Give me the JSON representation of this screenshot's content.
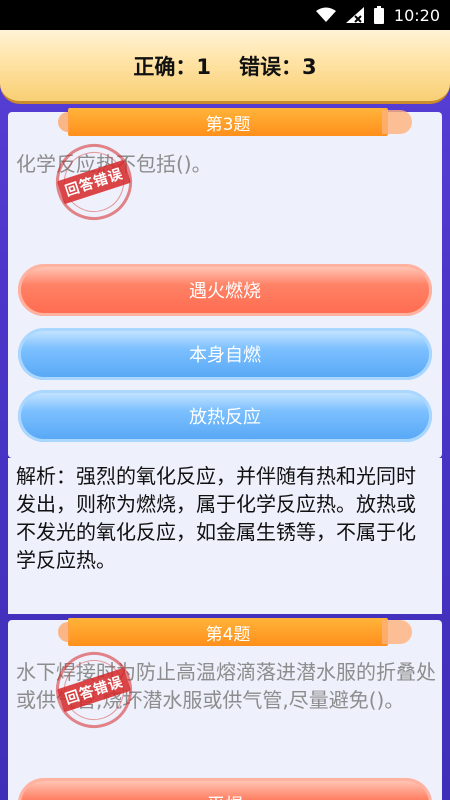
{
  "status_bar": {
    "time": "10:20"
  },
  "score": {
    "correct": "正确：1",
    "wrong": "错误：3"
  },
  "questions": [
    {
      "number_label": "第3题",
      "text": "化学反应热不包括()。",
      "stamp": "回答错误",
      "options": [
        "遇火燃烧",
        "本身自燃",
        "放热反应"
      ]
    },
    {
      "number_label": "第4题",
      "text": "水下焊接时为防止高温熔滴落进潜水服的折叠处或供气管,烧坏潜水服或供气管,尽量避免()。",
      "stamp": "回答错误",
      "options": [
        "平焊"
      ]
    }
  ],
  "explanation": "解析：强烈的氧化反应，并伴随有热和光同时发出，则称为燃烧，属于化学反应热。放热或不发光的氧化反应，如金属生锈等，不属于化学反应热。",
  "colors": {
    "wrong_option": "#ff6a4f",
    "neutral_option": "#55a6f5",
    "ribbon": "#ff8f1b"
  }
}
